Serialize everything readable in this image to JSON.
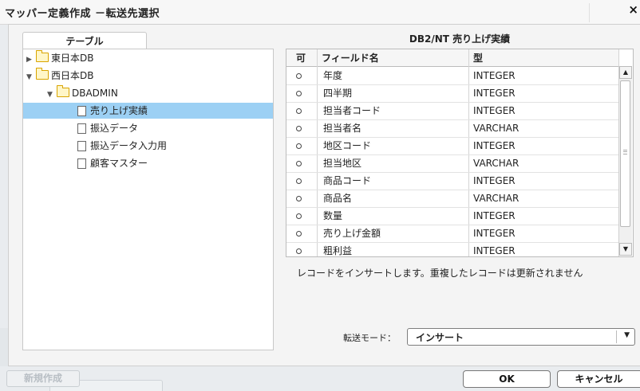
{
  "window": {
    "title": "マッパー定義作成  －転送先選択",
    "close_glyph": "×"
  },
  "tree": {
    "tab_label": "テーブル",
    "nodes": [
      {
        "label": "東日本DB",
        "arrow": "▶"
      },
      {
        "label": "西日本DB",
        "arrow": "▼"
      },
      {
        "label": "DBADMIN",
        "arrow": "▼"
      },
      {
        "label": "売り上げ実績"
      },
      {
        "label": "振込データ"
      },
      {
        "label": "振込データ入力用"
      },
      {
        "label": "顧客マスター"
      }
    ]
  },
  "table": {
    "title": "DB2/NT 売り上げ実績",
    "headers": {
      "col_enabled": "可",
      "col_field": "フィールド名",
      "col_type": "型"
    },
    "rows": [
      {
        "field": "年度",
        "type": "INTEGER"
      },
      {
        "field": "四半期",
        "type": "INTEGER"
      },
      {
        "field": "担当者コード",
        "type": "INTEGER"
      },
      {
        "field": "担当者名",
        "type": "VARCHAR"
      },
      {
        "field": "地区コード",
        "type": "INTEGER"
      },
      {
        "field": "担当地区",
        "type": "VARCHAR"
      },
      {
        "field": "商品コード",
        "type": "INTEGER"
      },
      {
        "field": "商品名",
        "type": "VARCHAR"
      },
      {
        "field": "数量",
        "type": "INTEGER"
      },
      {
        "field": "売り上げ金額",
        "type": "INTEGER"
      },
      {
        "field": "粗利益",
        "type": "INTEGER"
      }
    ],
    "scroll_up_glyph": "▲",
    "scroll_down_glyph": "▼"
  },
  "message": "レコードをインサートします。重複したレコードは更新されません",
  "transfer_mode": {
    "label": "転送モード：",
    "value": "インサート",
    "arrow": "▼"
  },
  "buttons": {
    "new": "新規作成",
    "ok": "OK",
    "cancel": "キャンセル"
  },
  "colors": {
    "selection": "#9cd0f4",
    "folder": "#fff6c8",
    "folder_border": "#d9a400"
  }
}
